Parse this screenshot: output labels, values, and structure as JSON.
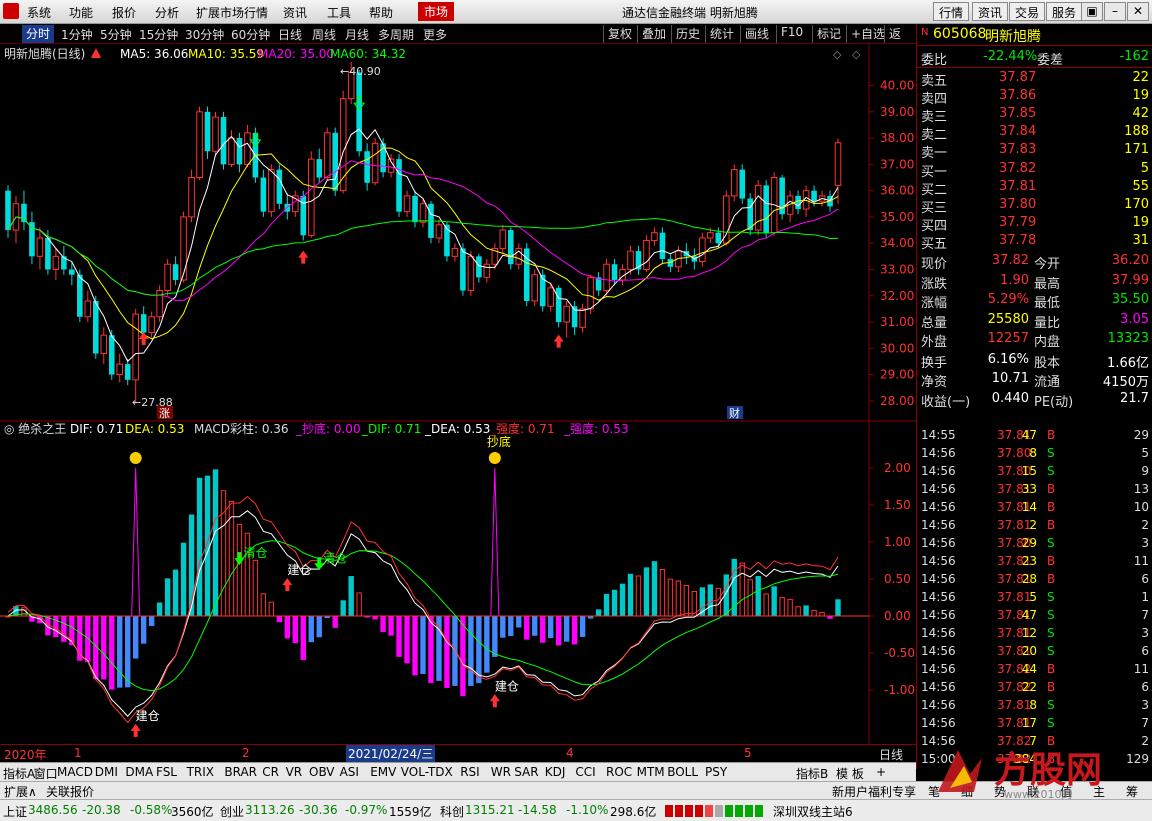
{
  "menu": {
    "items": [
      "系统",
      "功能",
      "报价",
      "分析",
      "扩展市场行情",
      "资讯",
      "工具",
      "帮助"
    ],
    "market": "市场",
    "title": "通达信金融终端  明新旭腾",
    "right_buttons": [
      "行情",
      "资讯",
      "交易",
      "服务"
    ]
  },
  "tabs": {
    "items": [
      "分时",
      "1分钟",
      "5分钟",
      "15分钟",
      "30分钟",
      "60分钟",
      "日线",
      "周线",
      "月线",
      "多周期",
      "更多"
    ],
    "active": "分时",
    "tools": [
      "复权",
      "叠加",
      "历史",
      "统计",
      "画线",
      "F10",
      "标记",
      "+自选",
      "返回"
    ]
  },
  "main_legend": {
    "name": "明新旭腾(日线)",
    "ma5": "MA5: 36.06",
    "ma10": "MA10: 35.59",
    "ma20": "MA20: 35.00",
    "ma60": "MA60: 34.32",
    "high_label": "40.90",
    "low_label": "27.88",
    "zhang": "涨",
    "cai": "财"
  },
  "price_axis": [
    "40.00",
    "39.00",
    "38.00",
    "37.00",
    "36.00",
    "35.00",
    "34.00",
    "33.00",
    "32.00",
    "31.00",
    "30.00",
    "29.00",
    "28.00"
  ],
  "sub_legend": {
    "name": "绝杀之王",
    "dif": "DIF: 0.71",
    "dea": "DEA: 0.53",
    "macd": "MACD彩柱: 0.36",
    "chaodi": "_抄底: 0.00",
    "dif2": "_DIF: 0.71",
    "dea2": "_DEA: 0.53",
    "qiangdu1": "_强度: 0.71",
    "qiangdu2": "_强度: 0.53"
  },
  "sub_axis": [
    "2.00",
    "1.50",
    "1.00",
    "0.50",
    "0.00",
    "-0.50",
    "-1.00"
  ],
  "signals": {
    "chaodi": "抄底",
    "jiancang": "建仓",
    "qingcang": "清仓"
  },
  "xaxis": {
    "year": "2020年",
    "m1": "1",
    "m2": "2",
    "date": "2021/02/24/三",
    "m4": "4",
    "m5": "5",
    "period": "日线"
  },
  "indicators": [
    "指标A",
    "窗口",
    "MACD",
    "DMI",
    "DMA",
    "FSL",
    "TRIX",
    "BRAR",
    "CR",
    "VR",
    "OBV",
    "ASI",
    "EMV",
    "VOL-TDX",
    "RSI",
    "WR",
    "SAR",
    "KDJ",
    "CCI",
    "ROC",
    "MTM",
    "BOLL",
    "PSY"
  ],
  "ind_right": [
    "指标B",
    "模 板",
    "+"
  ],
  "ext": {
    "expand": "扩展∧",
    "related": "关联报价",
    "promo": "新用户福利专享"
  },
  "quote": {
    "code": "605068",
    "name": "明新旭腾",
    "wb_label": "委比",
    "wb": "-22.44%",
    "wc_label": "委差",
    "wc": "-162",
    "sells": [
      {
        "l": "卖五",
        "p": "37.87",
        "v": "22"
      },
      {
        "l": "卖四",
        "p": "37.86",
        "v": "19"
      },
      {
        "l": "卖三",
        "p": "37.85",
        "v": "42"
      },
      {
        "l": "卖二",
        "p": "37.84",
        "v": "188"
      },
      {
        "l": "卖一",
        "p": "37.83",
        "v": "171"
      }
    ],
    "buys": [
      {
        "l": "买一",
        "p": "37.82",
        "v": "5"
      },
      {
        "l": "买二",
        "p": "37.81",
        "v": "55"
      },
      {
        "l": "买三",
        "p": "37.80",
        "v": "170"
      },
      {
        "l": "买四",
        "p": "37.79",
        "v": "19"
      },
      {
        "l": "买五",
        "p": "37.78",
        "v": "31"
      }
    ],
    "stats": [
      {
        "a": "现价",
        "av": "37.82",
        "b": "今开",
        "bv": "36.20",
        "ac": "red",
        "bc": "red"
      },
      {
        "a": "涨跌",
        "av": "1.90",
        "b": "最高",
        "bv": "37.99",
        "ac": "red",
        "bc": "red"
      },
      {
        "a": "涨幅",
        "av": "5.29%",
        "b": "最低",
        "bv": "35.50",
        "ac": "red",
        "bc": "green"
      },
      {
        "a": "总量",
        "av": "25580",
        "b": "量比",
        "bv": "3.05",
        "ac": "yellow",
        "bc": "mag"
      },
      {
        "a": "外盘",
        "av": "12257",
        "b": "内盘",
        "bv": "13323",
        "ac": "red",
        "bc": "green"
      },
      {
        "a": "换手",
        "av": "6.16%",
        "b": "股本",
        "bv": "1.66亿",
        "ac": "white",
        "bc": "white"
      },
      {
        "a": "净资",
        "av": "10.71",
        "b": "流通",
        "bv": "4150万",
        "ac": "white",
        "bc": "white"
      },
      {
        "a": "收益(一)",
        "av": "0.440",
        "b": "PE(动)",
        "bv": "21.7",
        "ac": "white",
        "bc": "white"
      }
    ]
  },
  "tape": [
    {
      "t": "14:55",
      "p": "37.81",
      "v": "47",
      "d": "B",
      "n": "29"
    },
    {
      "t": "14:56",
      "p": "37.80",
      "v": "8",
      "d": "S",
      "n": "5"
    },
    {
      "t": "14:56",
      "p": "37.80",
      "v": "15",
      "d": "S",
      "n": "9"
    },
    {
      "t": "14:56",
      "p": "37.81",
      "v": "33",
      "d": "B",
      "n": "13"
    },
    {
      "t": "14:56",
      "p": "37.81",
      "v": "14",
      "d": "B",
      "n": "10"
    },
    {
      "t": "14:56",
      "p": "37.81",
      "v": "2",
      "d": "B",
      "n": "2"
    },
    {
      "t": "14:56",
      "p": "37.80",
      "v": "29",
      "d": "S",
      "n": "3"
    },
    {
      "t": "14:56",
      "p": "37.81",
      "v": "23",
      "d": "B",
      "n": "11"
    },
    {
      "t": "14:56",
      "p": "37.81",
      "v": "28",
      "d": "B",
      "n": "6"
    },
    {
      "t": "14:56",
      "p": "37.81",
      "v": "5",
      "d": "S",
      "n": "1"
    },
    {
      "t": "14:56",
      "p": "37.81",
      "v": "47",
      "d": "S",
      "n": "7"
    },
    {
      "t": "14:56",
      "p": "37.81",
      "v": "12",
      "d": "S",
      "n": "3"
    },
    {
      "t": "14:56",
      "p": "37.81",
      "v": "20",
      "d": "S",
      "n": "6"
    },
    {
      "t": "14:56",
      "p": "37.82",
      "v": "44",
      "d": "B",
      "n": "11"
    },
    {
      "t": "14:56",
      "p": "37.82",
      "v": "22",
      "d": "B",
      "n": "6"
    },
    {
      "t": "14:56",
      "p": "37.81",
      "v": "8",
      "d": "S",
      "n": "3"
    },
    {
      "t": "14:56",
      "p": "37.81",
      "v": "17",
      "d": "S",
      "n": "7"
    },
    {
      "t": "14:56",
      "p": "37.82",
      "v": "7",
      "d": "B",
      "n": "2"
    },
    {
      "t": "15:00",
      "p": "37.82",
      "v": "384",
      "d": "B",
      "n": "129"
    }
  ],
  "bottom_tabs": [
    "笔",
    "细",
    "势",
    "联",
    "值",
    "主",
    "筹"
  ],
  "status": {
    "sh_label": "上证",
    "sh": "3486.56",
    "sh_chg": "-20.38",
    "sh_pct": "-0.58%",
    "sh_amt": "3560亿",
    "cy_label": "创业",
    "cy": "3113.26",
    "cy_chg": "-30.36",
    "cy_pct": "-0.97%",
    "cy_amt": "1559亿",
    "kc_label": "科创",
    "kc": "1315.21",
    "kc_chg": "-14.58",
    "kc_pct": "-1.10%",
    "kc_amt": "298.6亿",
    "line": "深圳双线主站6"
  },
  "watermark": "方股网",
  "watermark_url": "www.2010的",
  "chart_data": {
    "type": "candlestick",
    "title": "明新旭腾(日线)",
    "price_range": [
      27.5,
      41.2
    ],
    "candles": [
      [
        36,
        34.5,
        36.2,
        34.2
      ],
      [
        34.5,
        35.5,
        35.8,
        34.0
      ],
      [
        35.5,
        34.8,
        36.0,
        34.5
      ],
      [
        34.8,
        33.5,
        35.2,
        33.2
      ],
      [
        33.5,
        34.2,
        34.6,
        33.0
      ],
      [
        34.2,
        33.0,
        34.5,
        32.8
      ],
      [
        33.0,
        33.5,
        33.8,
        32.6
      ],
      [
        33.5,
        33.0,
        33.9,
        32.8
      ],
      [
        33.0,
        32.8,
        33.3,
        32.4
      ],
      [
        32.8,
        31.2,
        33.0,
        31.0
      ],
      [
        31.2,
        31.8,
        32.2,
        31.0
      ],
      [
        31.8,
        29.8,
        32.0,
        29.6
      ],
      [
        29.8,
        30.5,
        30.8,
        29.4
      ],
      [
        30.5,
        29.0,
        30.7,
        28.8
      ],
      [
        29.0,
        29.4,
        29.8,
        28.7
      ],
      [
        29.4,
        28.8,
        29.6,
        28.6
      ],
      [
        28.8,
        31.3,
        31.5,
        27.9
      ],
      [
        31.3,
        30.6,
        31.6,
        30.3
      ],
      [
        30.6,
        31.2,
        31.4,
        30.4
      ],
      [
        31.2,
        32.2,
        32.4,
        31.0
      ],
      [
        32.2,
        33.2,
        33.4,
        32.0
      ],
      [
        33.2,
        32.6,
        33.5,
        32.4
      ],
      [
        32.6,
        35.0,
        35.2,
        32.5
      ],
      [
        35.0,
        36.5,
        36.8,
        34.8
      ],
      [
        36.5,
        39.0,
        39.2,
        36.4
      ],
      [
        39.0,
        37.5,
        39.2,
        37.2
      ],
      [
        37.5,
        38.8,
        39.0,
        37.3
      ],
      [
        38.8,
        37.0,
        39.0,
        36.8
      ],
      [
        37.0,
        38.0,
        38.3,
        36.9
      ],
      [
        38.0,
        37.0,
        38.2,
        36.7
      ],
      [
        37.0,
        38.2,
        38.5,
        36.9
      ],
      [
        38.2,
        36.5,
        38.4,
        36.3
      ],
      [
        36.5,
        35.2,
        36.8,
        35.0
      ],
      [
        35.2,
        36.8,
        37.0,
        35.0
      ],
      [
        36.8,
        35.5,
        37.0,
        35.3
      ],
      [
        35.5,
        35.2,
        35.9,
        34.9
      ],
      [
        35.2,
        35.8,
        36.0,
        35.0
      ],
      [
        35.8,
        34.3,
        36.0,
        34.1
      ],
      [
        34.3,
        37.2,
        37.5,
        34.2
      ],
      [
        37.2,
        36.5,
        37.6,
        36.3
      ],
      [
        36.5,
        38.2,
        38.4,
        36.4
      ],
      [
        38.2,
        36.0,
        38.4,
        35.8
      ],
      [
        36.0,
        39.5,
        39.8,
        35.9
      ],
      [
        39.5,
        40.5,
        40.9,
        39.3
      ],
      [
        40.5,
        37.5,
        40.6,
        37.3
      ],
      [
        37.5,
        36.3,
        37.8,
        36.0
      ],
      [
        36.3,
        37.8,
        38.0,
        36.2
      ],
      [
        37.8,
        36.7,
        38.0,
        36.5
      ],
      [
        36.7,
        37.2,
        37.4,
        36.5
      ],
      [
        37.2,
        35.2,
        37.4,
        35.0
      ],
      [
        35.2,
        35.8,
        36.0,
        35.0
      ],
      [
        35.8,
        34.8,
        36.0,
        34.6
      ],
      [
        34.8,
        35.5,
        35.7,
        34.6
      ],
      [
        35.5,
        34.2,
        35.6,
        34.0
      ],
      [
        34.2,
        34.7,
        34.9,
        34.0
      ],
      [
        34.7,
        33.5,
        34.8,
        33.3
      ],
      [
        33.5,
        33.8,
        34.0,
        33.3
      ],
      [
        33.8,
        32.2,
        34.0,
        32.0
      ],
      [
        32.2,
        33.5,
        33.7,
        32.0
      ],
      [
        33.5,
        32.7,
        33.6,
        32.5
      ],
      [
        32.7,
        33.2,
        33.4,
        32.5
      ],
      [
        33.2,
        33.8,
        34.0,
        33.0
      ],
      [
        33.8,
        34.5,
        34.7,
        33.6
      ],
      [
        34.5,
        33.2,
        34.6,
        33.0
      ],
      [
        33.2,
        33.8,
        34.0,
        33.0
      ],
      [
        33.8,
        31.8,
        34.0,
        31.6
      ],
      [
        31.8,
        32.8,
        33.0,
        31.6
      ],
      [
        32.8,
        31.6,
        33.0,
        31.4
      ],
      [
        31.6,
        32.3,
        32.5,
        31.4
      ],
      [
        32.3,
        31.0,
        32.4,
        30.8
      ],
      [
        31.0,
        31.6,
        31.8,
        30.4
      ],
      [
        31.6,
        30.8,
        31.8,
        30.5
      ],
      [
        30.8,
        31.5,
        31.7,
        30.6
      ],
      [
        31.5,
        32.7,
        32.8,
        31.3
      ],
      [
        32.7,
        32.2,
        32.9,
        32.0
      ],
      [
        32.2,
        33.2,
        33.4,
        32.0
      ],
      [
        33.2,
        32.6,
        33.4,
        32.4
      ],
      [
        32.6,
        33.0,
        33.2,
        32.4
      ],
      [
        33.0,
        33.7,
        33.9,
        32.8
      ],
      [
        33.7,
        33.0,
        33.9,
        32.8
      ],
      [
        33.0,
        34.1,
        34.3,
        32.9
      ],
      [
        34.1,
        34.4,
        34.6,
        33.9
      ],
      [
        34.4,
        33.4,
        34.6,
        33.2
      ],
      [
        33.4,
        33.1,
        33.6,
        32.9
      ],
      [
        33.1,
        33.7,
        33.9,
        32.9
      ],
      [
        33.7,
        33.5,
        34.0,
        33.2
      ],
      [
        33.5,
        33.3,
        33.8,
        33.0
      ],
      [
        33.3,
        34.2,
        34.4,
        33.1
      ],
      [
        34.2,
        34.4,
        34.6,
        34.0
      ],
      [
        34.4,
        34.0,
        34.6,
        33.8
      ],
      [
        34.0,
        35.8,
        36.0,
        33.9
      ],
      [
        35.8,
        36.8,
        37.0,
        35.6
      ],
      [
        36.8,
        35.7,
        37.0,
        35.5
      ],
      [
        35.7,
        34.5,
        35.9,
        34.3
      ],
      [
        34.5,
        36.2,
        36.4,
        34.3
      ],
      [
        36.2,
        34.4,
        36.4,
        34.2
      ],
      [
        34.4,
        36.5,
        36.7,
        34.3
      ],
      [
        36.5,
        35.1,
        36.6,
        34.9
      ],
      [
        35.1,
        35.8,
        36.0,
        34.8
      ],
      [
        35.8,
        35.3,
        36.0,
        35.1
      ],
      [
        35.3,
        36.0,
        36.2,
        35.0
      ],
      [
        36.0,
        35.6,
        36.2,
        35.4
      ],
      [
        35.6,
        35.8,
        36.0,
        35.4
      ],
      [
        35.8,
        35.4,
        36.0,
        35.2
      ],
      [
        36.2,
        37.82,
        37.99,
        35.5
      ]
    ]
  }
}
